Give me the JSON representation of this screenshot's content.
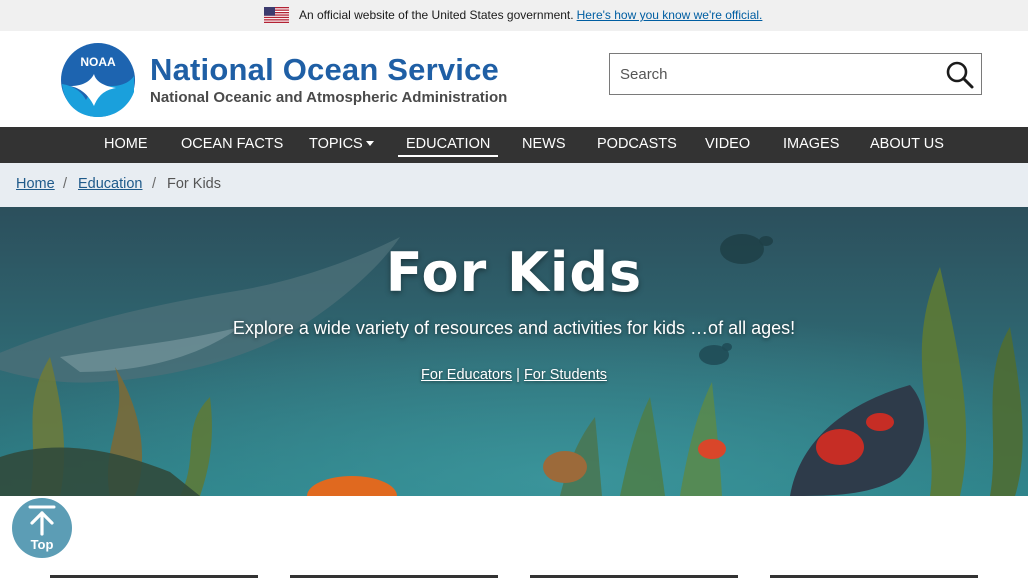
{
  "gov_banner": {
    "text": "An official website of the United States government.",
    "link": "Here's how you know we're official."
  },
  "header": {
    "logo_text": "NOAA",
    "title": "National Ocean Service",
    "subtitle": "National Oceanic and Atmospheric Administration",
    "search_placeholder": "Search",
    "search_icon": "search-icon"
  },
  "nav": {
    "items": [
      {
        "label": "HOME"
      },
      {
        "label": "OCEAN FACTS"
      },
      {
        "label": "TOPICS"
      },
      {
        "label": "EDUCATION"
      },
      {
        "label": "NEWS"
      },
      {
        "label": "PODCASTS"
      },
      {
        "label": "VIDEO"
      },
      {
        "label": "IMAGES"
      },
      {
        "label": "ABOUT US"
      }
    ],
    "active": "EDUCATION"
  },
  "breadcrumb": {
    "items": [
      {
        "label": "Home"
      },
      {
        "label": "Education"
      },
      {
        "label": "For Kids"
      }
    ],
    "separator": "/"
  },
  "hero": {
    "title": "For Kids",
    "subtitle": "Explore a wide variety of resources and activities for kids …of all ages!",
    "link_educators": "For Educators",
    "link_separator": "|",
    "link_students": "For Students"
  },
  "top_button": {
    "label": "Top",
    "icon": "arrow-up-icon"
  },
  "colors": {
    "brand_blue": "#1f5fa5",
    "nav_bg": "#333333",
    "breadcrumb_bg": "#e8edf2",
    "link_blue": "#1e5a8a",
    "top_button": "#5c9db5"
  }
}
